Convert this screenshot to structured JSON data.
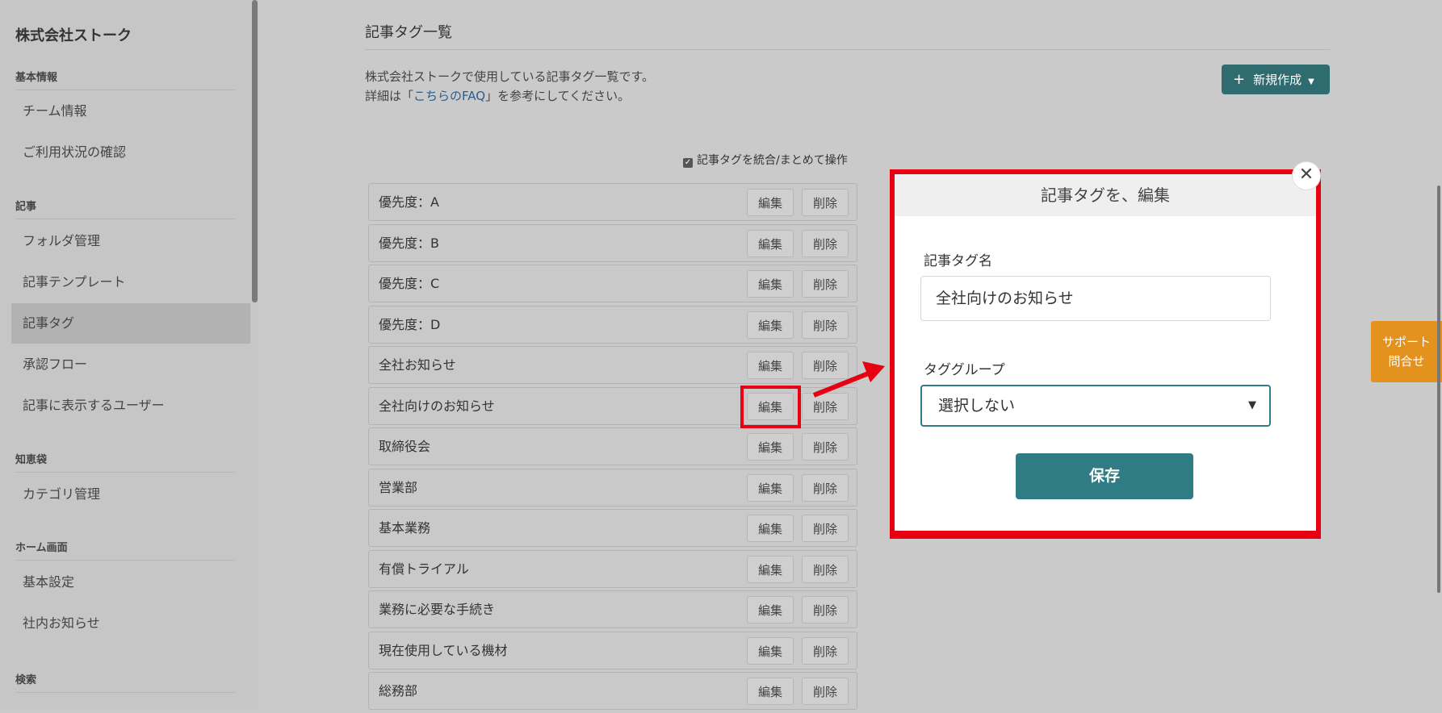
{
  "sidebar": {
    "company": "株式会社ストーク",
    "sections": {
      "basic": {
        "label": "基本情報",
        "items": [
          "チーム情報",
          "ご利用状況の確認"
        ]
      },
      "article": {
        "label": "記事",
        "items": [
          "フォルダ管理",
          "記事テンプレート",
          "記事タグ",
          "承認フロー",
          "記事に表示するユーザー"
        ]
      },
      "knowledge": {
        "label": "知恵袋",
        "items": [
          "カテゴリ管理"
        ]
      },
      "home": {
        "label": "ホーム画面",
        "items": [
          "基本設定",
          "社内お知らせ"
        ]
      },
      "search": {
        "label": "検索"
      }
    },
    "active_item": "記事タグ"
  },
  "main": {
    "title": "記事タグ一覧",
    "desc_line1": "株式会社ストークで使用している記事タグ一覧です。",
    "desc_line2_before": "詳細は「",
    "desc_link": "こちらのFAQ",
    "desc_line2_after": "」を参考にしてください。",
    "new_button": "新規作成",
    "bulk_label": "記事タグを統合/まとめて操作",
    "edit_label": "編集",
    "delete_label": "削除",
    "tags": [
      "優先度：A",
      "優先度：B",
      "優先度：C",
      "優先度：D",
      "全社お知らせ",
      "全社向けのお知らせ",
      "取締役会",
      "営業部",
      "基本業務",
      "有償トライアル",
      "業務に必要な手続き",
      "現在使用している機材",
      "総務部"
    ]
  },
  "modal": {
    "title": "記事タグを、編集",
    "close": "✕",
    "name_label": "記事タグ名",
    "name_value": "全社向けのお知らせ",
    "group_label": "タググループ",
    "group_value": "選択しない",
    "save": "保存"
  },
  "support": {
    "line1": "サポート",
    "line2": "問合せ"
  },
  "colors": {
    "accent": "#2f7c84",
    "highlight": "#e60012",
    "support": "#e2921d"
  }
}
